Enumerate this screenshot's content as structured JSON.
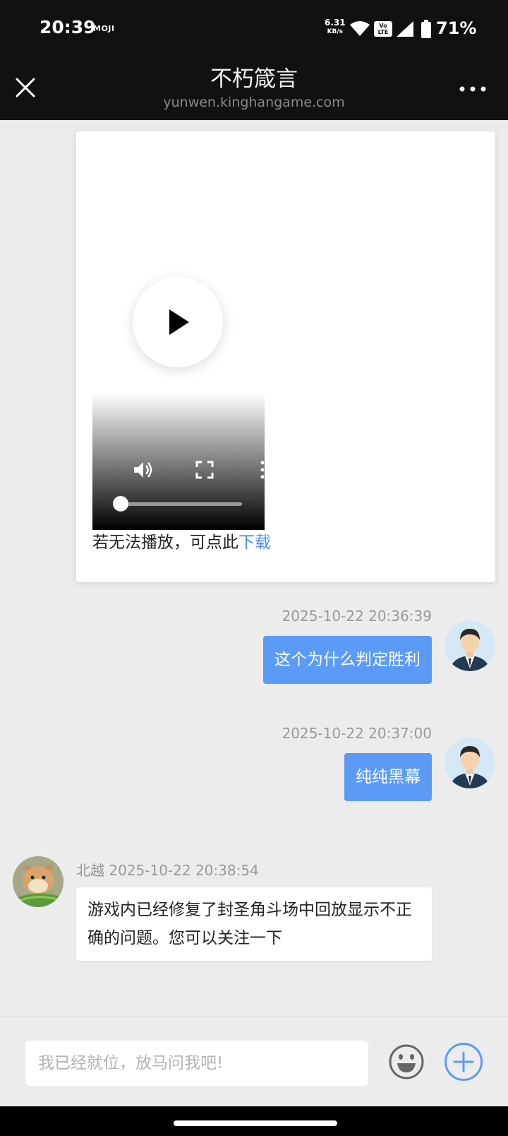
{
  "status_bar": {
    "time": "20:39",
    "app_badge": "MOJI",
    "net_speed": "6.31",
    "net_unit": "KB/s",
    "volte_top": "Vo",
    "volte_bottom": "LTE",
    "battery_pct": "71%"
  },
  "header": {
    "title": "不朽箴言",
    "subtitle": "yunwen.kinghangame.com"
  },
  "video_message": {
    "progress": 0,
    "fallback_text": "若无法播放，可点此",
    "download_link": "下载"
  },
  "messages": [
    {
      "side": "right",
      "timestamp": "2025-10-22 20:36:39",
      "text": "这个为什么判定胜利"
    },
    {
      "side": "right",
      "timestamp": "2025-10-22 20:37:00",
      "text": "纯纯黑幕"
    },
    {
      "side": "left",
      "sender": "北越",
      "timestamp": "2025-10-22 20:38:54",
      "text": "游戏内已经修复了封圣角斗场中回放显示不正确的问题。您可以关注一下"
    }
  ],
  "input": {
    "placeholder": "我已经就位，放马问我吧!"
  },
  "colors": {
    "accent": "#5b9bf6",
    "link": "#4a8cf0",
    "header_bg": "#111111",
    "chat_bg": "#ececec"
  },
  "icons": {
    "close": "close-icon",
    "more": "more-horizontal-icon",
    "play": "play-icon",
    "volume": "volume-icon",
    "fullscreen": "fullscreen-icon",
    "emoji": "emoji-icon",
    "plus": "plus-circle-icon"
  }
}
